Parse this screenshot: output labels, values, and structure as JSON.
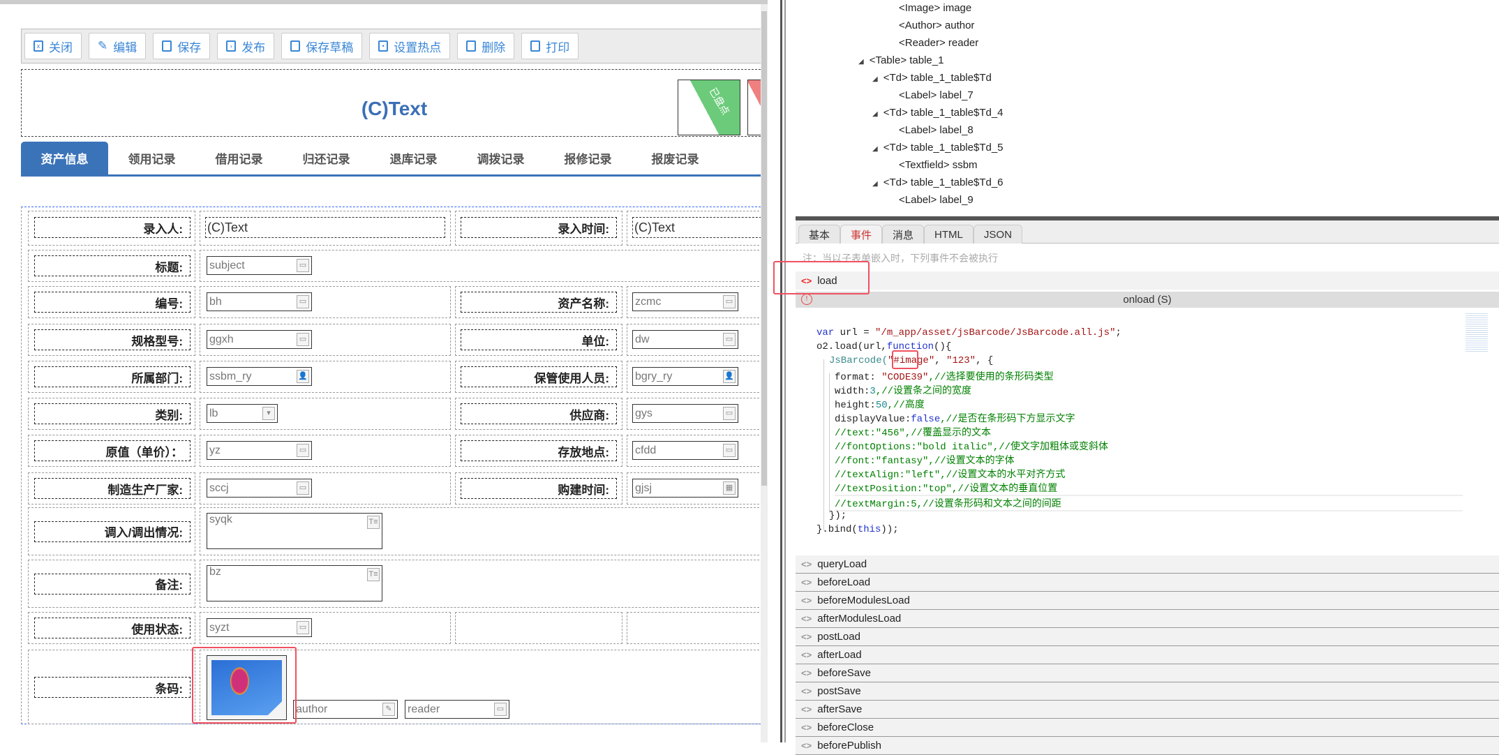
{
  "toolbar": {
    "buttons": [
      {
        "label": "关闭",
        "icon": "close-icon"
      },
      {
        "label": "编辑",
        "icon": "pencil-icon"
      },
      {
        "label": "保存",
        "icon": "save-icon"
      },
      {
        "label": "发布",
        "icon": "publish-icon"
      },
      {
        "label": "保存草稿",
        "icon": "save-draft-icon"
      },
      {
        "label": "设置热点",
        "icon": "hotspot-icon"
      },
      {
        "label": "删除",
        "icon": "trash-icon"
      },
      {
        "label": "打印",
        "icon": "print-icon"
      }
    ]
  },
  "header": {
    "title": "(C)Text",
    "stamp": "已盘点"
  },
  "tabs": [
    "资产信息",
    "领用记录",
    "借用记录",
    "归还记录",
    "退库记录",
    "调拨记录",
    "报修记录",
    "报废记录"
  ],
  "form": {
    "enter_by_label": "录入人:",
    "enter_by_value": "(C)Text",
    "enter_time_label": "录入时间:",
    "enter_time_value": "(C)Text",
    "subject_label": "标题:",
    "subject": "subject",
    "bh_label": "编号:",
    "bh": "bh",
    "zcmc_label": "资产名称:",
    "zcmc": "zcmc",
    "ggxh_label": "规格型号:",
    "ggxh": "ggxh",
    "dw_label": "单位:",
    "dw": "dw",
    "ssbm_label": "所属部门:",
    "ssbm": "ssbm_ry",
    "bgry_label": "保管使用人员:",
    "bgry": "bgry_ry",
    "lb_label": "类别:",
    "lb": "lb",
    "gys_label": "供应商:",
    "gys": "gys",
    "yz_label": "原值（单价）：",
    "yz": "yz",
    "cfdd_label": "存放地点:",
    "cfdd": "cfdd",
    "sccj_label": "制造生产厂家:",
    "sccj": "sccj",
    "gjsj_label": "购建时间:",
    "gjsj": "gjsj",
    "syqk_label": "调入/调出情况:",
    "syqk": "syqk",
    "bz_label": "备注:",
    "bz": "bz",
    "syzt_label": "使用状态:",
    "syzt": "syzt",
    "barcode_label": "条码:",
    "author": "author",
    "reader": "reader"
  },
  "tree": [
    {
      "text": "<Image> image",
      "level": 3
    },
    {
      "text": "<Author> author",
      "level": 3
    },
    {
      "text": "<Reader> reader",
      "level": 3
    },
    {
      "text": "<Table> table_1",
      "level": 1,
      "expand": true
    },
    {
      "text": "<Td> table_1_table$Td",
      "level": 2,
      "expand": true
    },
    {
      "text": "<Label> label_7",
      "level": 3
    },
    {
      "text": "<Td> table_1_table$Td_4",
      "level": 2,
      "expand": true
    },
    {
      "text": "<Label> label_8",
      "level": 3
    },
    {
      "text": "<Td> table_1_table$Td_5",
      "level": 2,
      "expand": true
    },
    {
      "text": "<Textfield> ssbm",
      "level": 3
    },
    {
      "text": "<Td> table_1_table$Td_6",
      "level": 2,
      "expand": true
    },
    {
      "text": "<Label> label_9",
      "level": 3
    }
  ],
  "panel_tabs": [
    "基本",
    "事件",
    "消息",
    "HTML",
    "JSON"
  ],
  "panel_active": "事件",
  "note": "注：当以子表单嵌入时，下列事件不会被执行",
  "load_event": "load",
  "onload_header": "onload (S)",
  "code": {
    "l1a": "var",
    " l1b": " url = ",
    "l1c": "\"/m_app/asset/jsBarcode/JsBarcode.all.js\"",
    "l1d": ";",
    "l2a": "o2.load(url,",
    "l2b": "function",
    "l2c": "(){",
    "l3a": "JsBarcode(",
    "l3b": "\"#image\"",
    "l3c": ", ",
    "l3d": "\"123\"",
    "l3e": ", {",
    "l4a": "format: ",
    "l4b": "\"CODE39\"",
    "l4c": ",//选择要使用的条形码类型",
    "l5a": "width:",
    "l5b": "3",
    "l5c": ",//设置条之间的宽度",
    "l6a": "height:",
    "l6b": "50",
    "l6c": ",//高度",
    "l7a": "displayValue:",
    "l7b": "false",
    "l7c": ",//是否在条形码下方显示文字",
    "l8": "//text:\"456\",//覆盖显示的文本",
    "l9": "//fontOptions:\"bold italic\",//使文字加粗体或变斜体",
    "l10": "//font:\"fantasy\",//设置文本的字体",
    "l11": "//textAlign:\"left\",//设置文本的水平对齐方式",
    "l12": "//textPosition:\"top\",//设置文本的垂直位置",
    "l13": "//textMargin:5,//设置条形码和文本之间的间距",
    "l14": "});",
    "l15a": "}.bind(",
    "l15b": "this",
    "l15c": "));"
  },
  "events": [
    "queryLoad",
    "beforeLoad",
    "beforeModulesLoad",
    "afterModulesLoad",
    "postLoad",
    "afterLoad",
    "beforeSave",
    "postSave",
    "afterSave",
    "beforeClose",
    "beforePublish"
  ]
}
